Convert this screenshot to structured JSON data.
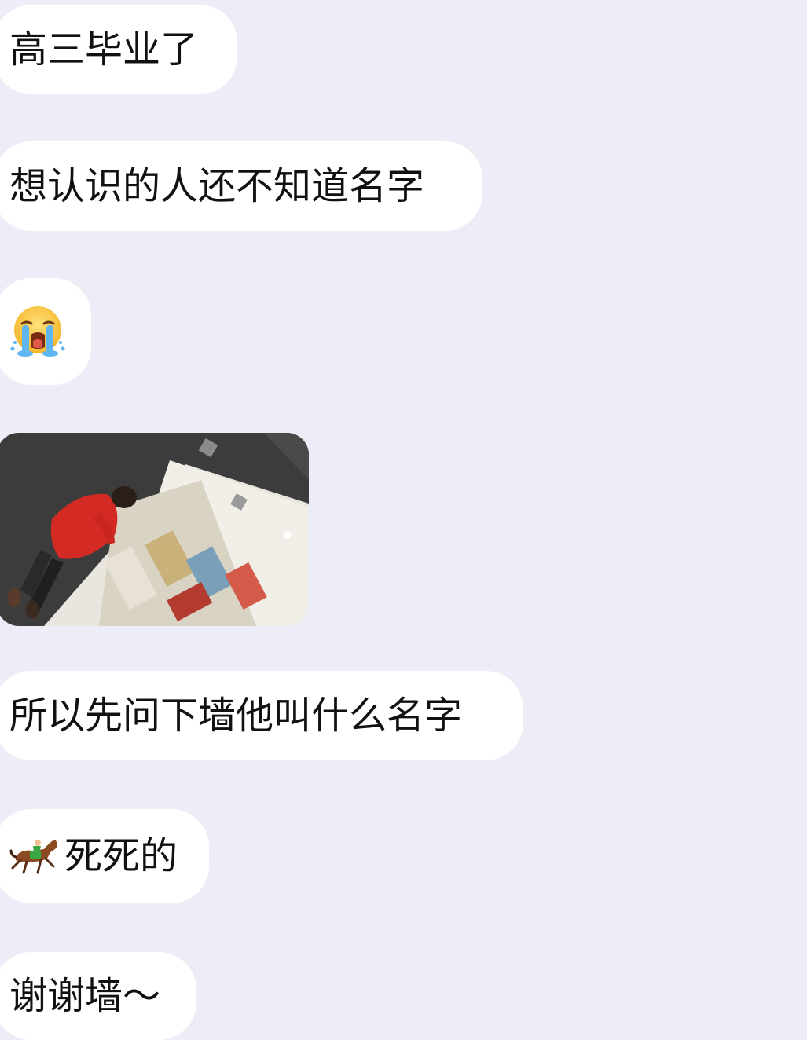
{
  "messages": [
    {
      "id": "m1",
      "text": "高三毕业了"
    },
    {
      "id": "m2",
      "text": "想认识的人还不知道名字"
    },
    {
      "id": "m3",
      "emoji": "loudly-crying-face-icon"
    },
    {
      "id": "m4",
      "image": "photo of a person in red shirt inside a mall"
    },
    {
      "id": "m5",
      "text": "所以先问下墙他叫什么名字"
    },
    {
      "id": "m6",
      "emoji": "horse-racing-icon",
      "text": "死死的"
    },
    {
      "id": "m7",
      "text": "谢谢墙～"
    }
  ],
  "colors": {
    "background": "#ededf7",
    "bubble": "#ffffff",
    "text": "#111111"
  }
}
